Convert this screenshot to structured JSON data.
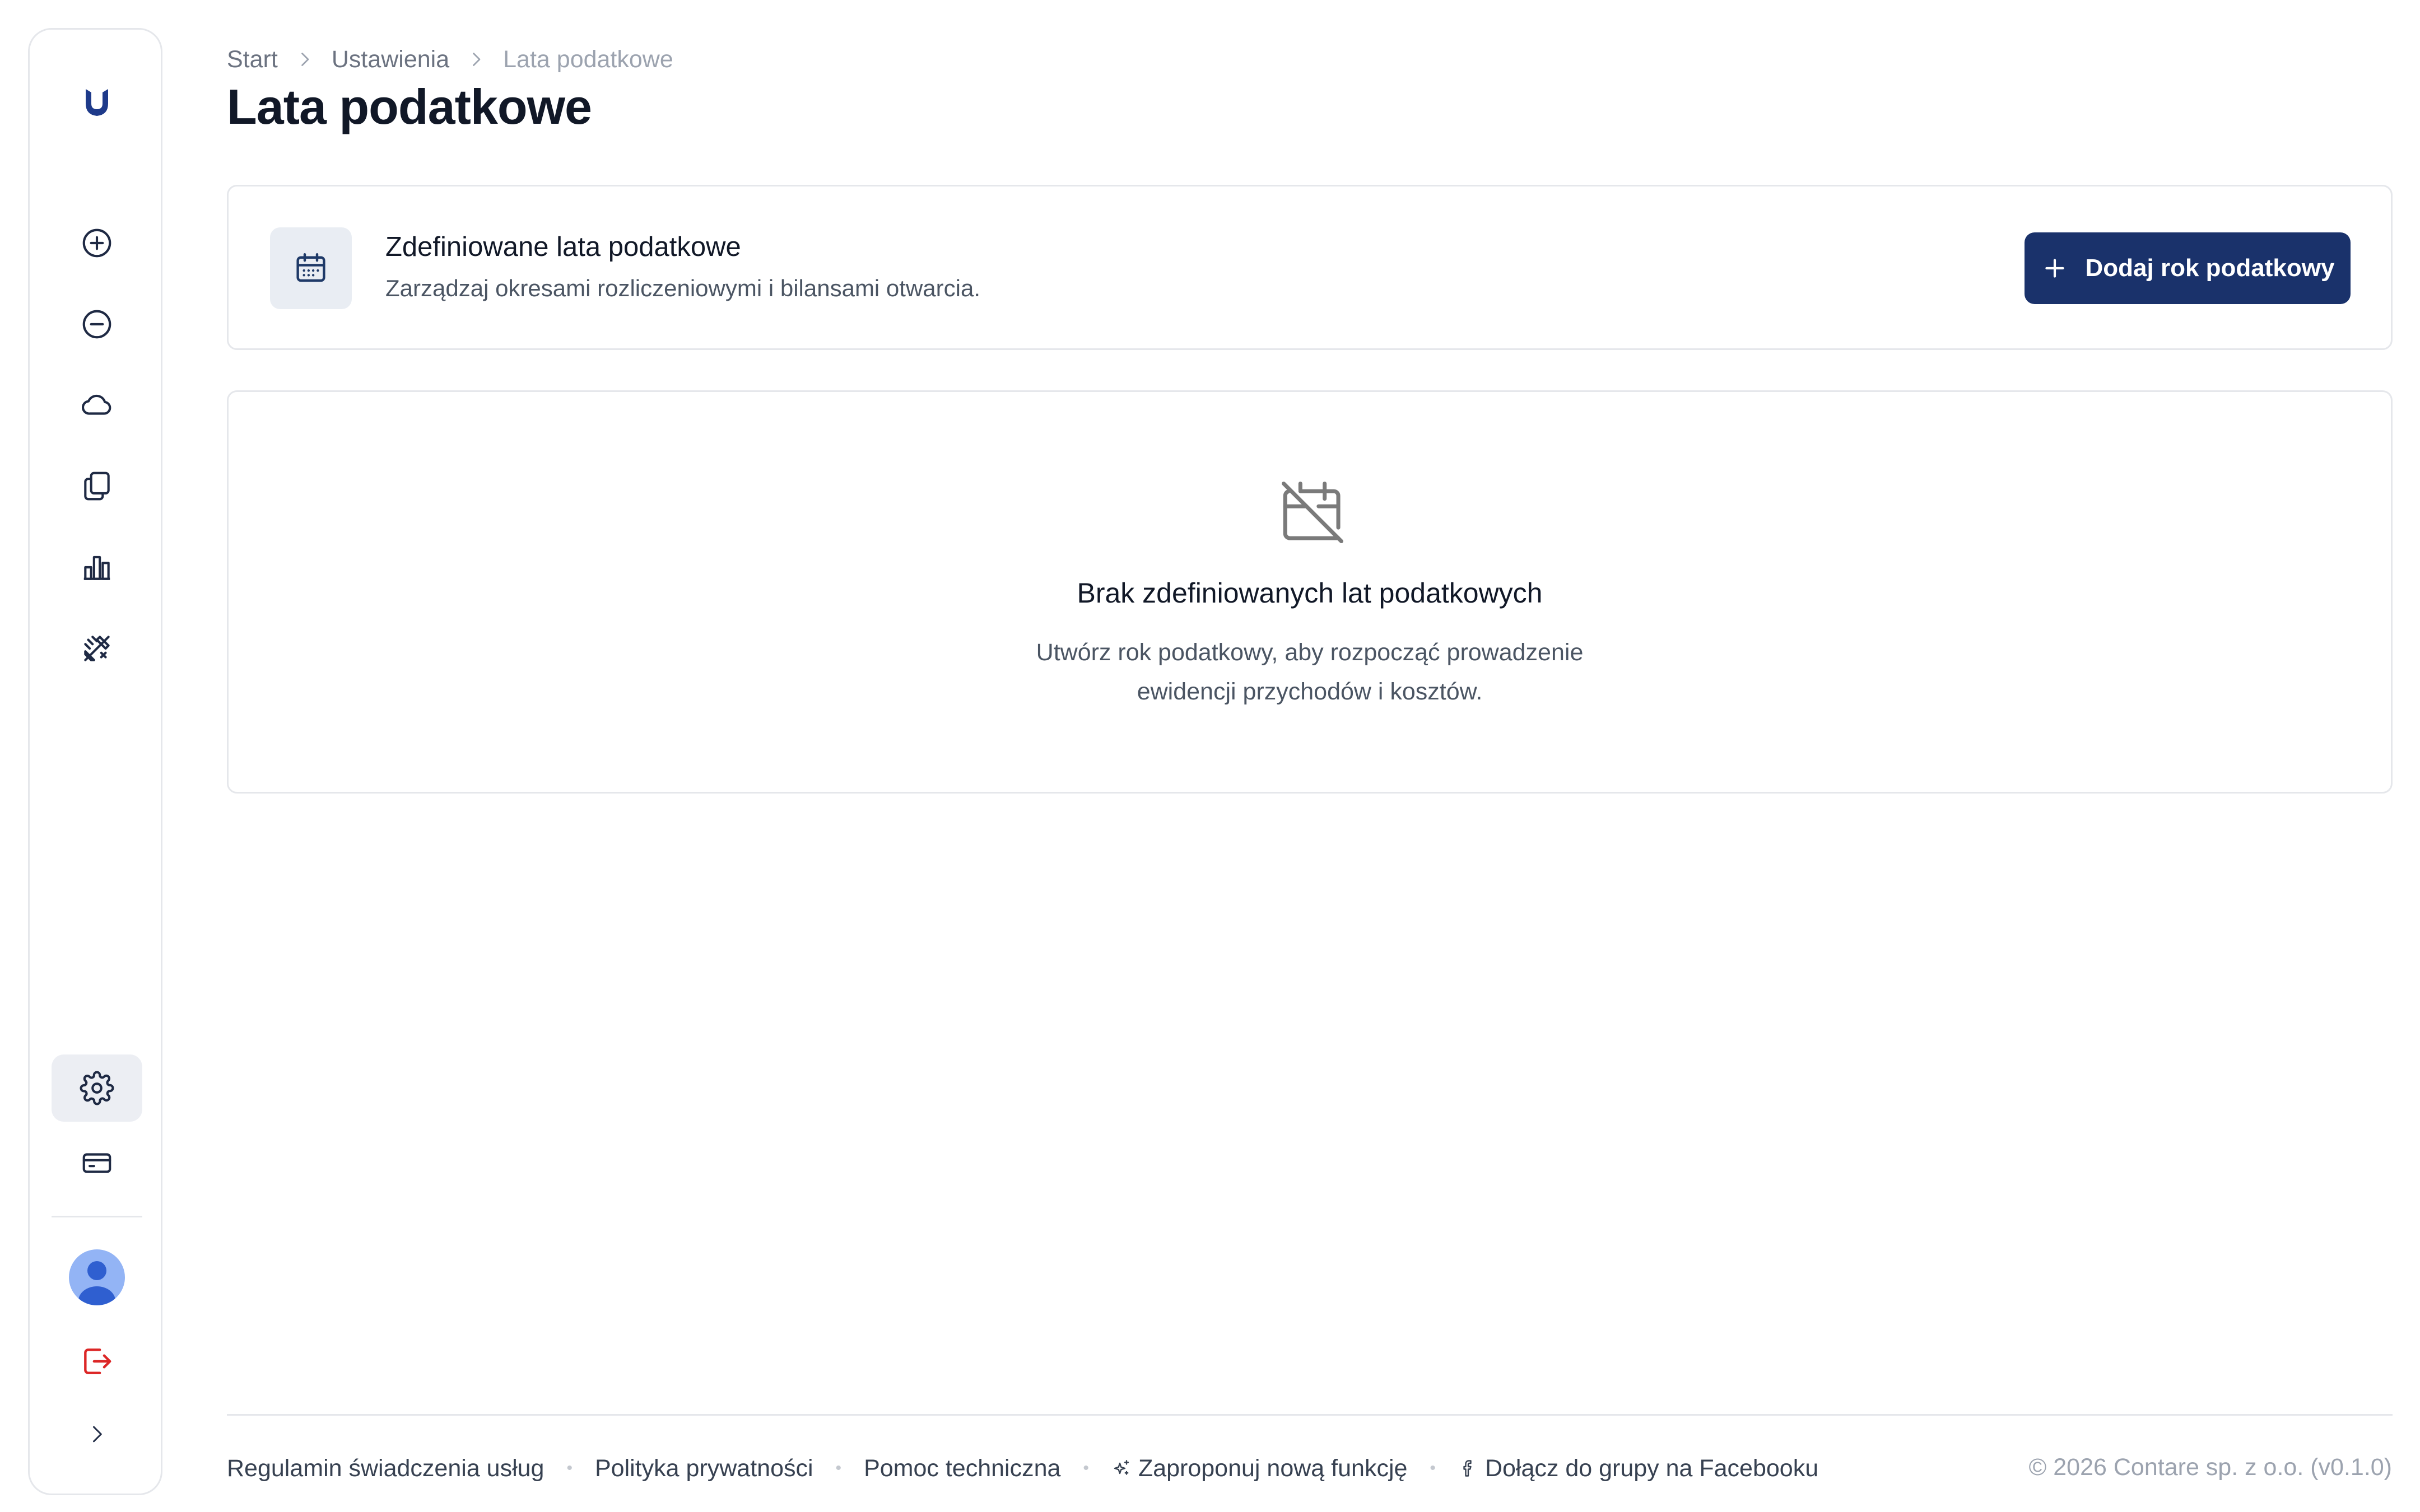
{
  "breadcrumb": {
    "items": [
      "Start",
      "Ustawienia"
    ],
    "current": "Lata podatkowe"
  },
  "page": {
    "title": "Lata podatkowe"
  },
  "header_card": {
    "title": "Zdefiniowane lata podatkowe",
    "subtitle": "Zarządzaj okresami rozliczeniowymi i bilansami otwarcia.",
    "icon": "calendar-icon",
    "add_button_label": "Dodaj rok podatkowy"
  },
  "empty_state": {
    "icon": "calendar-off-icon",
    "title": "Brak zdefiniowanych lat podatkowych",
    "description": "Utwórz rok podatkowy, aby rozpocząć prowadzenie ewidencji przychodów i kosztów."
  },
  "sidebar": {
    "items": [
      {
        "icon": "plus-circle-icon"
      },
      {
        "icon": "minus-circle-icon"
      },
      {
        "icon": "cloud-icon"
      },
      {
        "icon": "documents-icon"
      },
      {
        "icon": "bar-chart-icon"
      },
      {
        "icon": "tools-icon"
      }
    ],
    "bottom_items": [
      {
        "icon": "gear-icon",
        "active": true
      },
      {
        "icon": "credit-card-icon"
      }
    ]
  },
  "footer": {
    "links": [
      "Regulamin świadczenia usług",
      "Polityka prywatności",
      "Pomoc techniczna",
      "Zaproponuj nową funkcję",
      "Dołącz do grupy na Facebooku"
    ],
    "copyright": "© 2026 Contare sp. z o.o. (v0.1.0)"
  },
  "colors": {
    "primary": "#1a326b",
    "logout": "#dc2626",
    "avatar_bg": "#93b4f5"
  }
}
